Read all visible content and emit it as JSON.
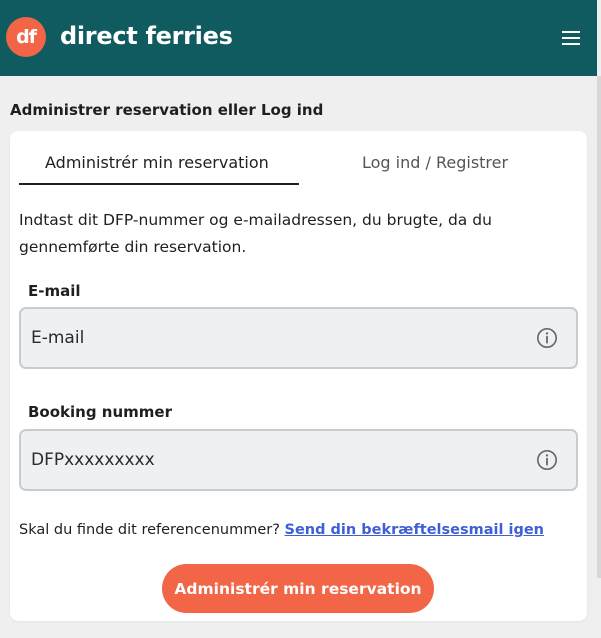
{
  "header": {
    "logo_text": "df",
    "brand_name": "direct ferries",
    "menu_icon": "hamburger-menu-icon",
    "background_color": "#0f5b5f",
    "accent_color": "#f26546"
  },
  "page": {
    "title": "Administrer reservation eller Log ind"
  },
  "tabs": {
    "manage_label": "Administrér min reservation",
    "login_label": "Log ind / Registrer",
    "active": "manage"
  },
  "form": {
    "description": "Indtast dit DFP-nummer og e-mailadressen, du brugte, da du gennemførte din reservation.",
    "email": {
      "label": "E-mail",
      "placeholder": "E-mail",
      "value": "",
      "info_icon": "info-circle-icon"
    },
    "booking": {
      "label": "Booking nummer",
      "placeholder": "DFPxxxxxxxxx",
      "value": "",
      "info_icon": "info-circle-icon"
    },
    "helper_text": "Skal du finde dit referencenummer?",
    "resend_link": "Send din bekræftelsesmail igen",
    "link_color": "#3f5fd6",
    "submit_label": "Administrér min reservation"
  }
}
